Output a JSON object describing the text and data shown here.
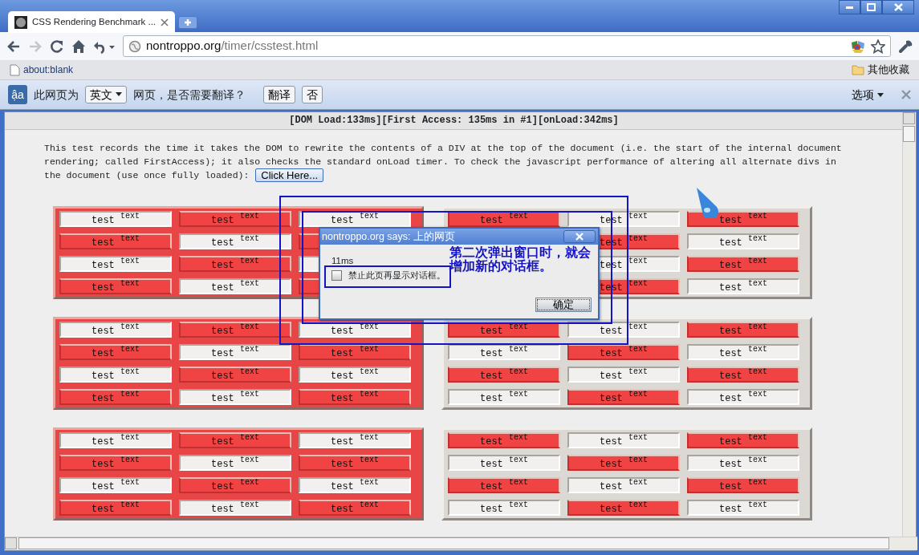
{
  "window": {
    "tab_title": "CSS Rendering Benchmark ..."
  },
  "toolbar": {
    "forward_disabled": true,
    "url_host": "nontroppo.org",
    "url_path": "/timer/csstest.html"
  },
  "bookmarks": {
    "items": [
      {
        "label": "about:blank"
      }
    ],
    "other": "其他收藏"
  },
  "translate_bar": {
    "icon": "ậa",
    "prefix": "此网页为",
    "language": "英文",
    "question": "网页，是否需要翻译？",
    "translate_button": "翻译",
    "no_button": "否",
    "options": "选项"
  },
  "page": {
    "status": "[DOM Load:133ms][First Access: 135ms in #1][onLoad:342ms]",
    "description": "This test records the time it takes the DOM to rewrite the contents of a DIV at the top of the document (i.e. the start of the internal document rendering; called FirstAccess); it also checks the standard onLoad timer. To check the javascript performance of altering all alternate divs in",
    "description_end": "the document (use once fully loaded):",
    "button": "Click Here...",
    "panels": [
      {
        "kind": "filled",
        "cells": [
          {
            "red": false,
            "label": "test",
            "sup": "text"
          },
          {
            "red": true,
            "label": "test",
            "sup": "text"
          },
          {
            "red": false,
            "label": "test",
            "sup": "text"
          },
          {
            "red": true,
            "label": "test",
            "sup": "text"
          },
          {
            "red": false,
            "label": "test",
            "sup": "text"
          },
          {
            "red": true
          },
          {
            "red": false,
            "label": "test",
            "sup": "text"
          },
          {
            "red": true,
            "label": "test",
            "sup": "text"
          },
          {
            "red": false
          },
          {
            "red": true,
            "label": "test",
            "sup": "text"
          },
          {
            "red": false,
            "label": "test",
            "sup": "text"
          },
          {
            "red": true
          }
        ]
      },
      {
        "kind": "plain",
        "cells": [
          {
            "red": true,
            "label": "test",
            "sup": "text"
          },
          {
            "red": false,
            "label": "test",
            "sup": "text"
          },
          {
            "red": true,
            "label": "test",
            "sup": "text"
          },
          {},
          {
            "red": true,
            "label": "test",
            "sup": "text"
          },
          {
            "red": false,
            "label": "test",
            "sup": "text"
          },
          {},
          {
            "red": false,
            "label": "test",
            "sup": "text"
          },
          {
            "red": true,
            "label": "test",
            "sup": "text"
          },
          {},
          {
            "red": true,
            "label": "test",
            "sup": "text"
          },
          {
            "red": false,
            "label": "test",
            "sup": "text"
          }
        ]
      },
      {
        "kind": "filled",
        "cells": [
          {
            "red": false,
            "label": "test",
            "sup": "text"
          },
          {
            "red": true,
            "label": "test",
            "sup": "text"
          },
          {
            "red": false,
            "label": "test",
            "sup": "text"
          },
          {
            "red": true,
            "label": "test",
            "sup": "text"
          },
          {
            "red": false,
            "label": "test",
            "sup": "text"
          },
          {
            "red": true,
            "label": "test",
            "sup": "text"
          },
          {
            "red": false,
            "label": "test",
            "sup": "text"
          },
          {
            "red": true,
            "label": "test",
            "sup": "text"
          },
          {
            "red": false,
            "label": "test",
            "sup": "text"
          },
          {
            "red": true,
            "label": "test",
            "sup": "text"
          },
          {
            "red": false,
            "label": "test",
            "sup": "text"
          },
          {
            "red": true,
            "label": "test",
            "sup": "text"
          }
        ]
      },
      {
        "kind": "plain",
        "cells": [
          {
            "red": true,
            "label": "test",
            "sup": "text"
          },
          {
            "red": false,
            "label": "test",
            "sup": "text"
          },
          {
            "red": true,
            "label": "test",
            "sup": "text"
          },
          {
            "red": false,
            "label": "test",
            "sup": "text"
          },
          {
            "red": true,
            "label": "test",
            "sup": "text"
          },
          {
            "red": false,
            "label": "test",
            "sup": "text"
          },
          {
            "red": true,
            "label": "test",
            "sup": "text"
          },
          {
            "red": false,
            "label": "test",
            "sup": "text"
          },
          {
            "red": true,
            "label": "test",
            "sup": "text"
          },
          {
            "red": false,
            "label": "test",
            "sup": "text"
          },
          {
            "red": true,
            "label": "test",
            "sup": "text"
          },
          {
            "red": false,
            "label": "test",
            "sup": "text"
          }
        ]
      },
      {
        "kind": "filled",
        "cells": [
          {
            "red": false,
            "label": "test",
            "sup": "text"
          },
          {
            "red": true,
            "label": "test",
            "sup": "text"
          },
          {
            "red": false,
            "label": "test",
            "sup": "text"
          },
          {
            "red": true,
            "label": "test",
            "sup": "text"
          },
          {
            "red": false,
            "label": "test",
            "sup": "text"
          },
          {
            "red": true,
            "label": "test",
            "sup": "text"
          },
          {
            "red": false,
            "label": "test",
            "sup": "text"
          },
          {
            "red": true,
            "label": "test",
            "sup": "text"
          },
          {
            "red": false,
            "label": "test",
            "sup": "text"
          },
          {
            "red": true,
            "label": "test",
            "sup": "text"
          },
          {
            "red": false,
            "label": "test",
            "sup": "text"
          },
          {
            "red": true,
            "label": "test",
            "sup": "text"
          }
        ]
      },
      {
        "kind": "plain",
        "cells": [
          {
            "red": true,
            "label": "test",
            "sup": "text"
          },
          {
            "red": false,
            "label": "test",
            "sup": "text"
          },
          {
            "red": true,
            "label": "test",
            "sup": "text"
          },
          {
            "red": false,
            "label": "test",
            "sup": "text"
          },
          {
            "red": true,
            "label": "test",
            "sup": "text"
          },
          {
            "red": false,
            "label": "test",
            "sup": "text"
          },
          {
            "red": true,
            "label": "test",
            "sup": "text"
          },
          {
            "red": false,
            "label": "test",
            "sup": "text"
          },
          {
            "red": true,
            "label": "test",
            "sup": "text"
          },
          {
            "red": false,
            "label": "test",
            "sup": "text"
          },
          {
            "red": true,
            "label": "test",
            "sup": "text"
          },
          {
            "red": false,
            "label": "test",
            "sup": "text"
          }
        ]
      }
    ]
  },
  "dialog": {
    "title": "nontroppo.org says: 上的网页",
    "message": "11ms",
    "checkbox": {
      "label": "禁止此页再显示对话框。",
      "checked": false
    },
    "ok_button": "确定"
  },
  "annotation": {
    "text": "第二次弹出窗口时，就会增加新的对话框。"
  }
}
